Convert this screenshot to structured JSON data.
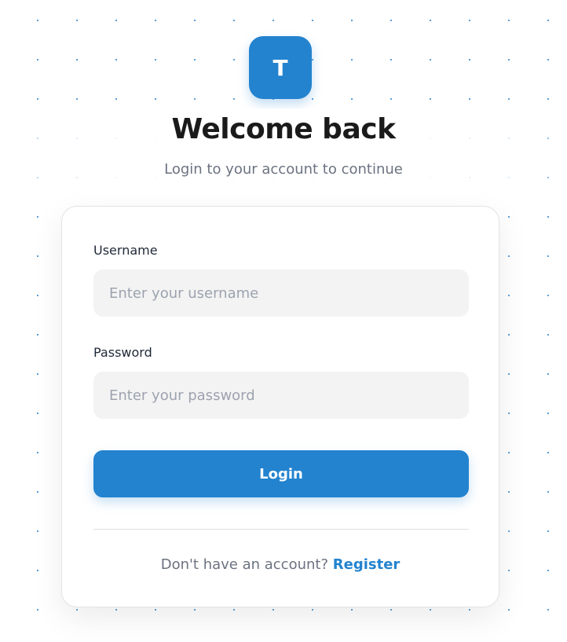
{
  "logo": {
    "letter": "T"
  },
  "header": {
    "title": "Welcome back",
    "subtitle": "Login to your account to continue"
  },
  "form": {
    "username": {
      "label": "Username",
      "value": "",
      "placeholder": "Enter your username"
    },
    "password": {
      "label": "Password",
      "value": "",
      "placeholder": "Enter your password"
    },
    "submit_label": "Login"
  },
  "footer": {
    "prompt": "Don't have an account?",
    "link_label": "Register"
  },
  "colors": {
    "accent": "#2383cf",
    "input_background": "#f3f3f3",
    "title_text": "#1a1a1a",
    "muted_text": "#6b7280"
  }
}
